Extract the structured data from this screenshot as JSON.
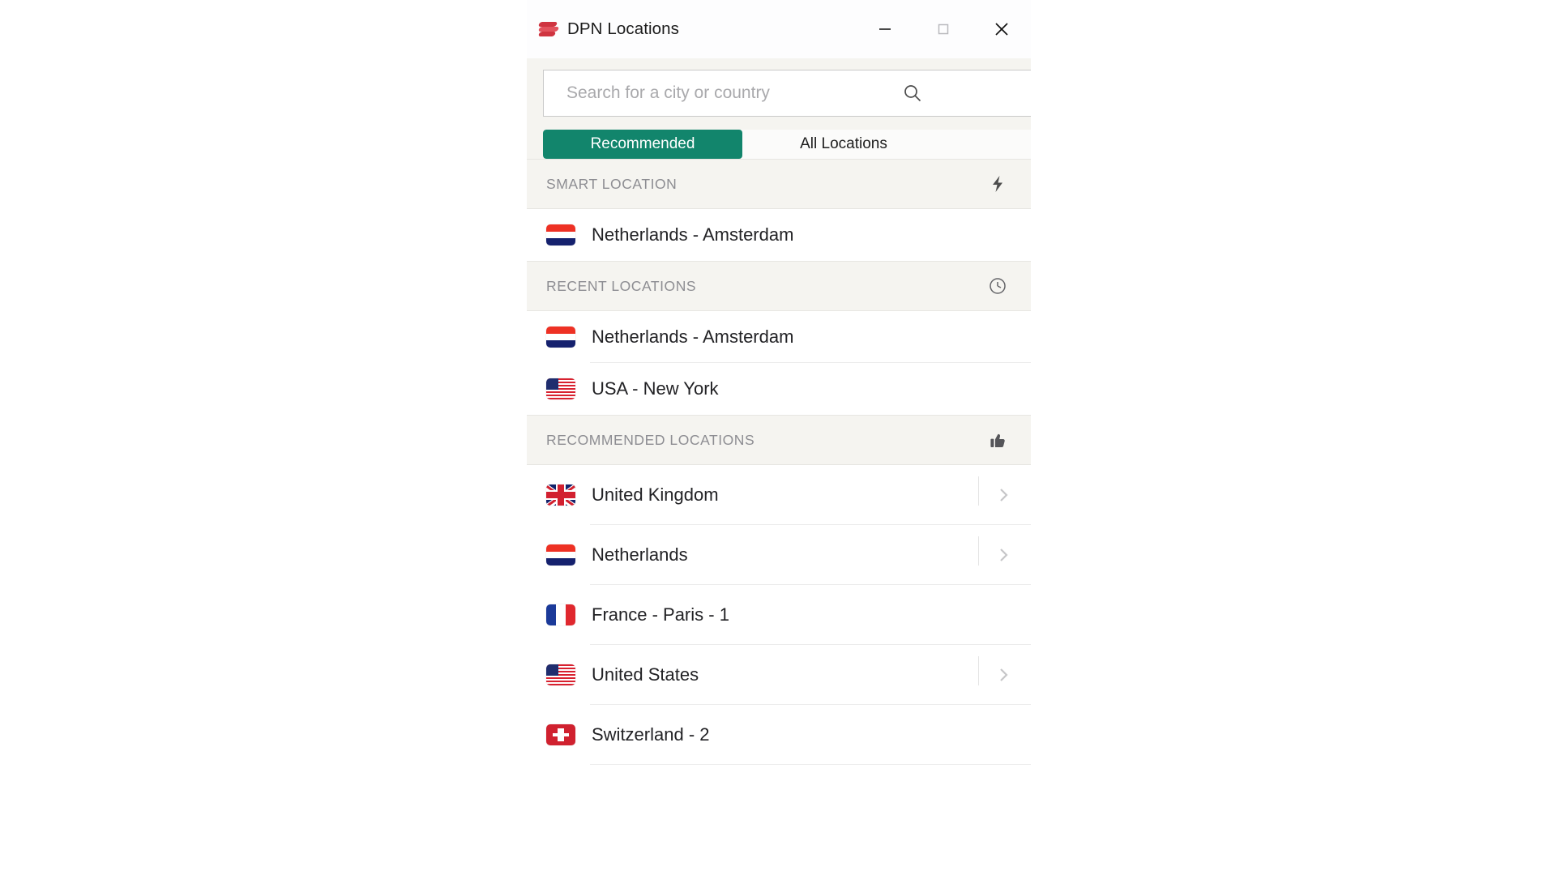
{
  "window": {
    "title": "DPN Locations",
    "logo_icon": "dpn-logo-icon",
    "controls": {
      "minimize": "minimize-icon",
      "maximize": "maximize-icon",
      "close": "close-icon"
    }
  },
  "search": {
    "placeholder": "Search for a city or country",
    "value": "",
    "icon": "search-icon"
  },
  "tabs": [
    {
      "label": "Recommended",
      "active": true
    },
    {
      "label": "All Locations",
      "active": false
    }
  ],
  "sections": [
    {
      "title": "SMART LOCATION",
      "icon": "lightning-bolt-icon",
      "rows": [
        {
          "label": "Netherlands - Amsterdam",
          "flag": "nl",
          "chevron": false
        }
      ]
    },
    {
      "title": "RECENT LOCATIONS",
      "icon": "clock-icon",
      "rows": [
        {
          "label": "Netherlands - Amsterdam",
          "flag": "nl",
          "chevron": false
        },
        {
          "label": "USA - New York",
          "flag": "us",
          "chevron": false
        }
      ]
    },
    {
      "title": "RECOMMENDED LOCATIONS",
      "icon": "thumbs-up-icon",
      "rows": [
        {
          "label": "United Kingdom",
          "flag": "gb",
          "chevron": true
        },
        {
          "label": "Netherlands",
          "flag": "nl",
          "chevron": true
        },
        {
          "label": "France - Paris - 1",
          "flag": "fr",
          "chevron": false
        },
        {
          "label": "United States",
          "flag": "us",
          "chevron": true
        },
        {
          "label": "Switzerland - 2",
          "flag": "ch",
          "chevron": false
        }
      ]
    }
  ],
  "colors": {
    "accent_teal": "#12856c",
    "logo_red": "#d93c48",
    "panel_bg": "#f5f4f0",
    "row_bg": "#ffffff",
    "section_label": "#8d8d92"
  }
}
